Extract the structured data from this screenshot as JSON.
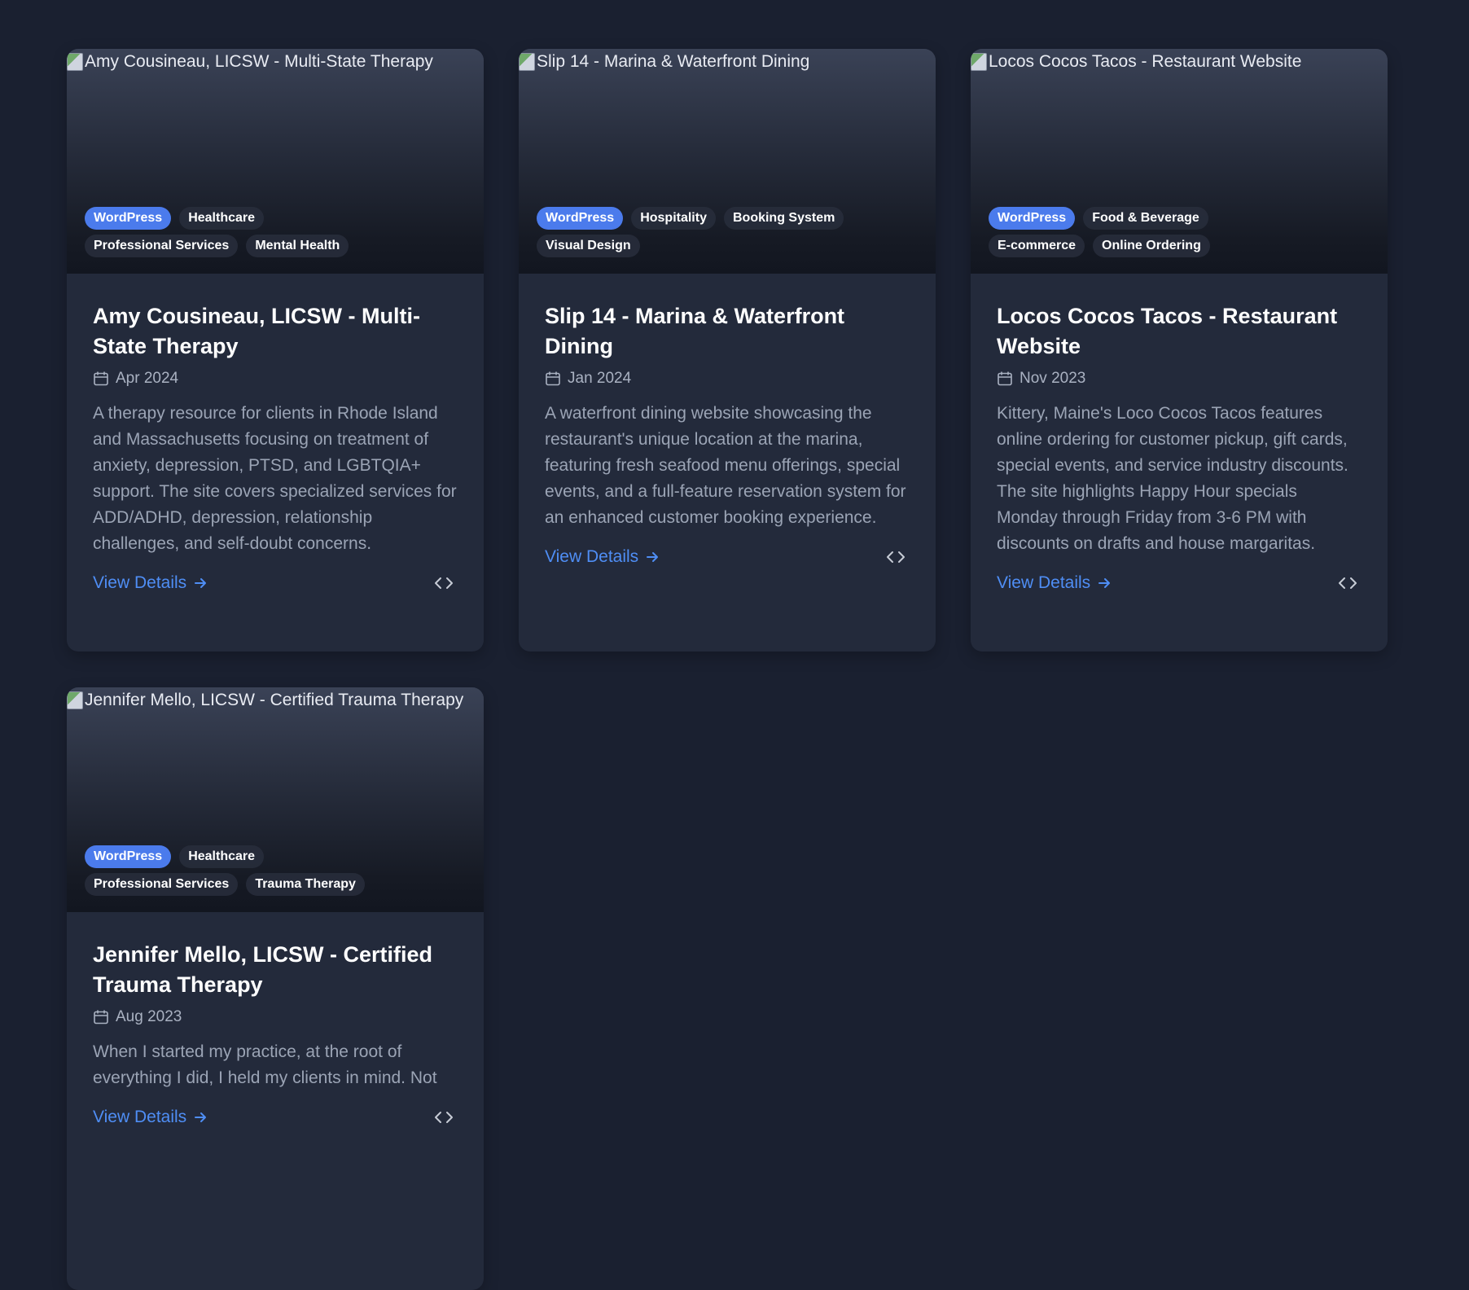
{
  "projects": [
    {
      "image_alt": "Amy Cousineau, LICSW - Multi-State Therapy",
      "tags": [
        "WordPress",
        "Healthcare",
        "Professional Services",
        "Mental Health"
      ],
      "title": "Amy Cousineau, LICSW - Multi-State Therapy",
      "date": "Apr 2024",
      "description": "A therapy resource for clients in Rhode Island and Massachusetts focusing on treatment of anxiety, depression, PTSD, and LGBTQIA+ support. The site covers specialized services for ADD/ADHD, depression, relationship challenges, and self-doubt concerns.",
      "link_label": "View Details"
    },
    {
      "image_alt": "Slip 14 - Marina & Waterfront Dining",
      "tags": [
        "WordPress",
        "Hospitality",
        "Booking System",
        "Visual Design"
      ],
      "title": "Slip 14 - Marina & Waterfront Dining",
      "date": "Jan 2024",
      "description": "A waterfront dining website showcasing the restaurant's unique location at the marina, featuring fresh seafood menu offerings, special events, and a full-feature reservation system for an enhanced customer booking experience.",
      "link_label": "View Details"
    },
    {
      "image_alt": "Locos Cocos Tacos - Restaurant Website",
      "tags": [
        "WordPress",
        "Food & Beverage",
        "E-commerce",
        "Online Ordering"
      ],
      "title": "Locos Cocos Tacos - Restaurant Website",
      "date": "Nov 2023",
      "description": "Kittery, Maine's Loco Cocos Tacos features online ordering for customer pickup, gift cards, special events, and service industry discounts. The site highlights Happy Hour specials Monday through Friday from 3-6 PM with discounts on drafts and house margaritas.",
      "link_label": "View Details"
    },
    {
      "image_alt": "Jennifer Mello, LICSW - Certified Trauma Therapy",
      "tags": [
        "WordPress",
        "Healthcare",
        "Professional Services",
        "Trauma Therapy"
      ],
      "title": "Jennifer Mello, LICSW - Certified Trauma Therapy",
      "date": "Aug 2023",
      "description": "When I started my practice, at the root of everything I did, I held my clients in mind. Not",
      "link_label": "View Details"
    }
  ],
  "colors": {
    "background": "#1a2030",
    "card": "#232a3b",
    "accent": "#4b7bec",
    "link": "#4f8ef5"
  },
  "icons": {
    "date": "calendar-icon",
    "link": "arrow-right-icon",
    "code": "code-icon"
  }
}
